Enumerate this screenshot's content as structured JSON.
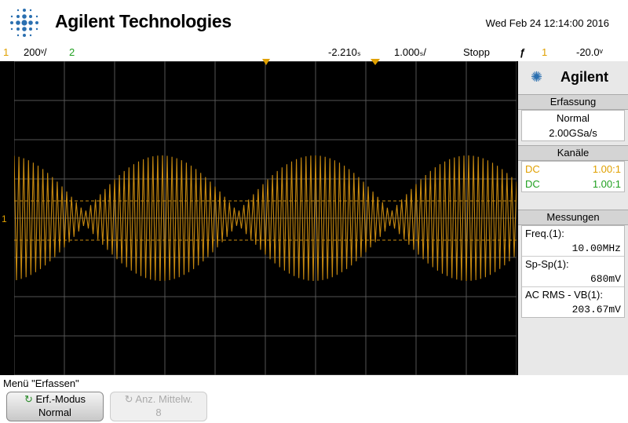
{
  "header": {
    "brand": "Agilent Technologies",
    "datetime": "Wed Feb 24 12:14:00 2016"
  },
  "status": {
    "ch1_num": "1",
    "ch1_scale": "200ᵛ/",
    "ch2_num": "2",
    "time_offset": "-2.210ₛ",
    "time_scale": "1.000ₛ/",
    "run_state": "Stopp",
    "trigger_source": "1",
    "trigger_level": "-20.0ᵛ"
  },
  "colors": {
    "ch1": "#e0a000",
    "ch2": "#20a020",
    "trace": "#c88a10"
  },
  "panel": {
    "brand": "Agilent",
    "acq": {
      "title": "Erfassung",
      "mode": "Normal",
      "rate": "2.00GSa/s"
    },
    "channels": {
      "title": "Kanäle",
      "items": [
        {
          "coupling": "DC",
          "probe": "1.00:1",
          "color": "#e0a000"
        },
        {
          "coupling": "DC",
          "probe": "1.00:1",
          "color": "#20a020"
        }
      ]
    },
    "measurements": {
      "title": "Messungen",
      "items": [
        {
          "label": "Freq.(1):",
          "value": "10.00MHz"
        },
        {
          "label": "Sp-Sp(1):",
          "value": "680mV"
        },
        {
          "label": "AC RMS - VB(1):",
          "value": "203.67mV"
        }
      ]
    }
  },
  "menu": {
    "label": "Menü \"Erfassen\"",
    "softkeys": [
      {
        "title": "Erf.-Modus",
        "value": "Normal",
        "enabled": true
      },
      {
        "title": "Anz. Mittelw.",
        "value": "8",
        "enabled": false
      }
    ]
  },
  "ch1_marker": "1"
}
